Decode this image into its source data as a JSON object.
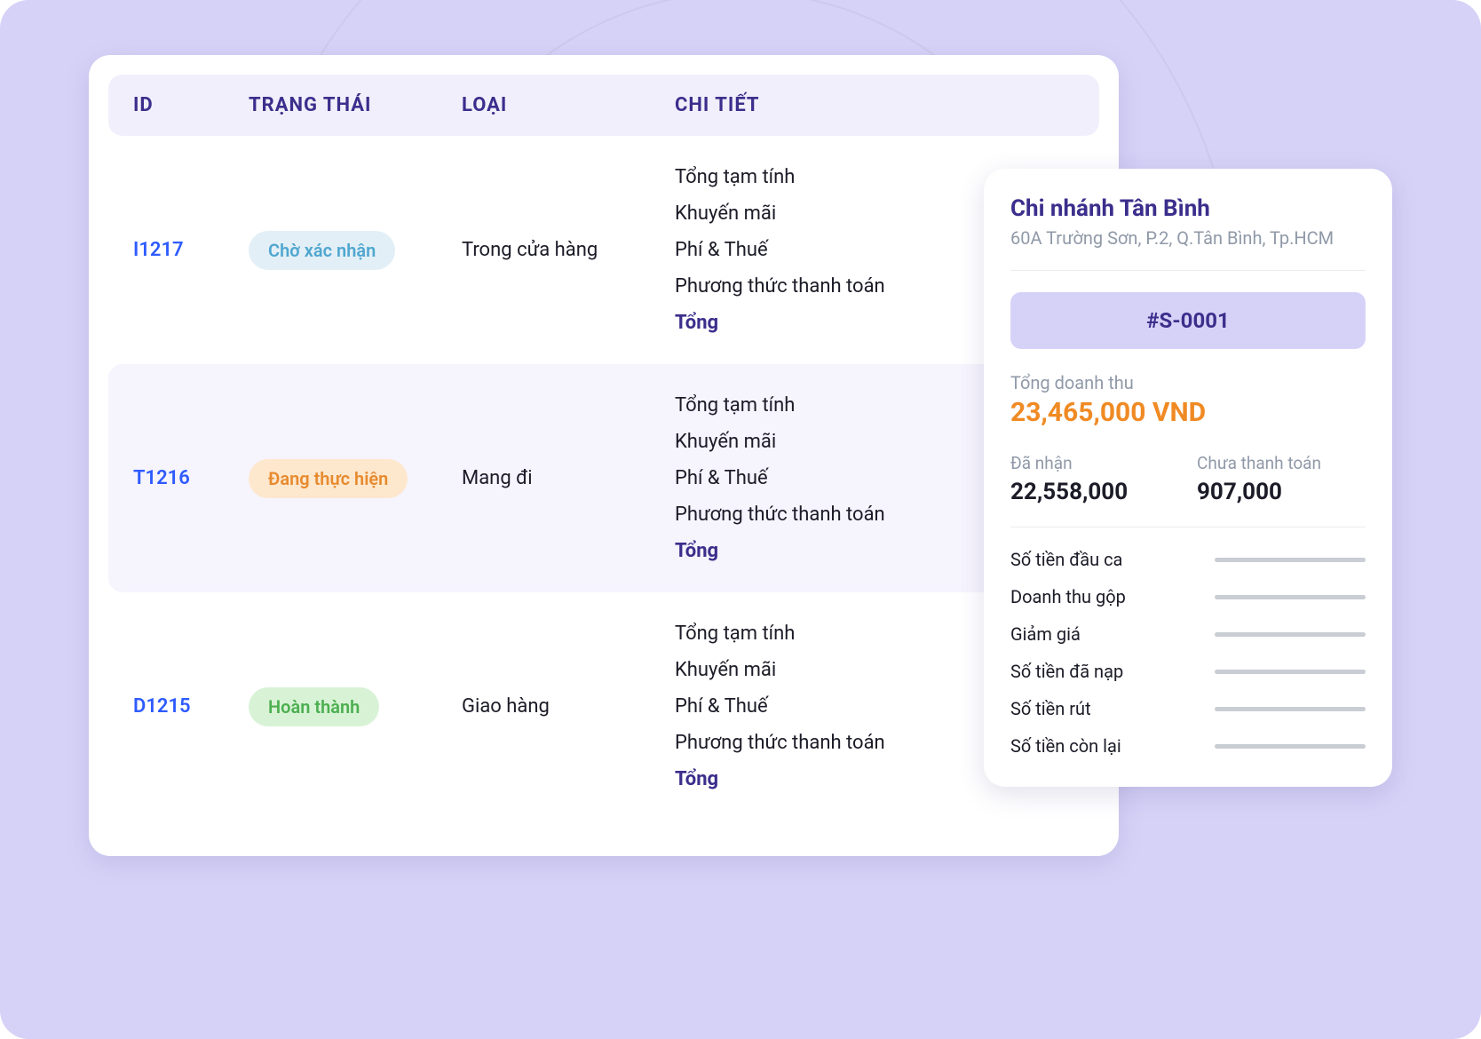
{
  "table": {
    "headers": {
      "id": "ID",
      "status": "TRẠNG THÁI",
      "type": "LOẠI",
      "detail": "CHI TIẾT"
    },
    "detail_labels": {
      "subtotal": "Tổng tạm tính",
      "promo": "Khuyến mãi",
      "fee": "Phí & Thuế",
      "payment": "Phương thức thanh toán",
      "total": "Tổng"
    },
    "rows": [
      {
        "id": "I1217",
        "status_text": "Chờ xác nhận",
        "status_color": "blue",
        "type": "Trong cửa hàng",
        "alt": false
      },
      {
        "id": "T1216",
        "status_text": "Đang thực hiện",
        "status_color": "orange",
        "type": "Mang đi",
        "alt": true
      },
      {
        "id": "D1215",
        "status_text": "Hoàn thành",
        "status_color": "green",
        "type": "Giao hàng",
        "alt": false
      }
    ]
  },
  "summary": {
    "branch_name": "Chi nhánh Tân Bình",
    "branch_addr": "60A Trường Sơn, P.2, Q.Tân Bình, Tp.HCM",
    "session_code": "#S-0001",
    "revenue_label": "Tổng doanh thu",
    "revenue_value": "23,465,000 VND",
    "received_label": "Đã nhận",
    "received_value": "22,558,000",
    "unpaid_label": "Chưa thanh toán",
    "unpaid_value": "907,000",
    "stats": [
      "Số tiền đầu ca",
      "Doanh thu gộp",
      "Giảm giá",
      "Số tiền đã nạp",
      "Số tiền rút",
      "Số tiền còn lại"
    ]
  }
}
